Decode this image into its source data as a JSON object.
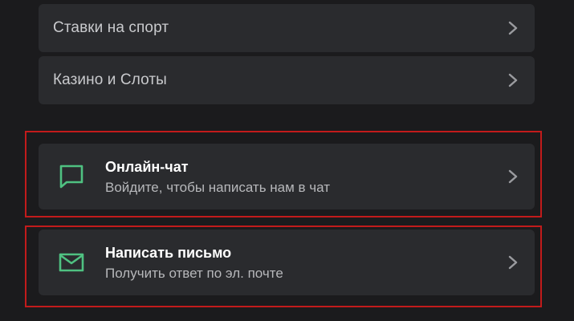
{
  "menu": {
    "items": [
      {
        "label": "Ставки на спорт",
        "icon": "chevron-right-icon"
      },
      {
        "label": "Казино и Слоты",
        "icon": "chevron-right-icon"
      }
    ]
  },
  "support": {
    "chat": {
      "title": "Онлайн-чат",
      "subtitle": "Войдите, чтобы написать нам в чат",
      "icon": "chat-bubble-icon"
    },
    "email": {
      "title": "Написать письмо",
      "subtitle": "Получить ответ по эл. почте",
      "icon": "envelope-icon"
    }
  },
  "colors": {
    "background": "#1b1b1d",
    "card": "#2a2b2e",
    "accent_icon": "#4fc181",
    "highlight_border": "#c21b1b"
  }
}
